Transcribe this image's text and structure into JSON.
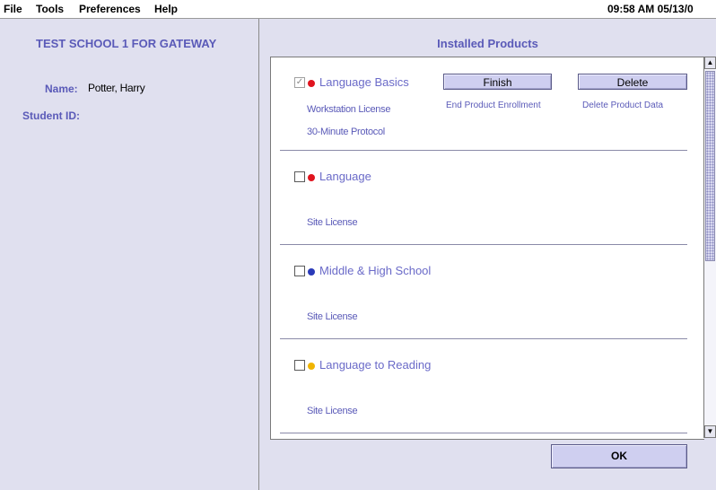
{
  "menu": {
    "items": [
      "File",
      "Tools",
      "Preferences",
      "Help"
    ],
    "clock": "09:58 AM 05/13/0"
  },
  "left": {
    "school": "TEST SCHOOL 1 FOR GATEWAY",
    "name_label": "Name:",
    "name_value": "Potter, Harry",
    "student_id_label": "Student ID:"
  },
  "right": {
    "title": "Installed Products"
  },
  "products": [
    {
      "name": "Language Basics",
      "checked": true,
      "dot_color": "#e0141e",
      "license": "Workstation License",
      "protocol": "30-Minute Protocol",
      "finish_label": "Finish",
      "finish_caption": "End Product Enrollment",
      "delete_label": "Delete",
      "delete_caption": "Delete Product Data"
    },
    {
      "name": "Language",
      "checked": false,
      "dot_color": "#e0141e",
      "license": "Site License"
    },
    {
      "name": "Middle & High School",
      "checked": false,
      "dot_color": "#2a3ab8",
      "license": "Site License"
    },
    {
      "name": "Language to Reading",
      "checked": false,
      "dot_color": "#f0b400",
      "license": "Site License"
    }
  ],
  "ok_label": "OK",
  "colors": {
    "accent": "#5a5ab8",
    "background": "#e0e0ef",
    "button": "#cfcff0"
  }
}
